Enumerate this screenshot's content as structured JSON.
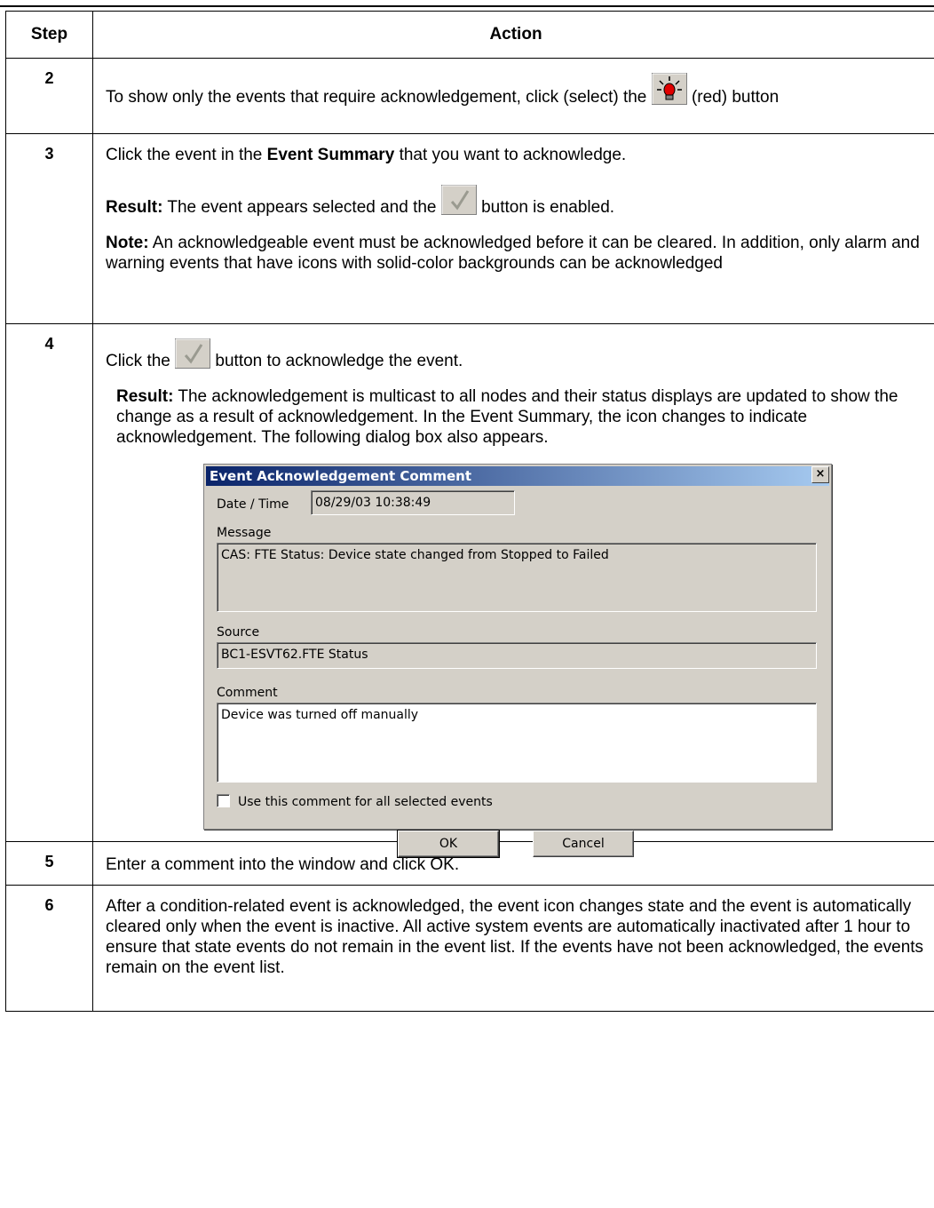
{
  "table": {
    "headers": {
      "step": "Step",
      "action": "Action"
    },
    "rows": [
      {
        "step": "2",
        "text_before_icon": "To show only the events that require acknowledgement, click (select) the",
        "text_after_icon": "(red) button",
        "icon": "red-alarm-light-icon"
      },
      {
        "step": "3",
        "line1_pre": "Click the event in the",
        "line1_bold": "Event Summary",
        "line1_post": "that you want to acknowledge.",
        "result_label": "Result:",
        "result_pre": "The event appears selected and the",
        "result_post": "button is enabled.",
        "note_label": "Note:",
        "note_text": "An acknowledgeable event must be acknowledged before it can be cleared. In addition, only alarm and warning events that have icons with solid-color backgrounds can be acknowledged"
      },
      {
        "step": "4",
        "click_pre": "Click the",
        "click_post": "button to acknowledge the event.",
        "result_label": "Result:",
        "result_text": "The acknowledgement is multicast to all nodes and their status displays are updated to show the change as a result of acknowledgement. In the Event Summary, the icon changes to indicate acknowledgement. The following dialog box also appears."
      },
      {
        "step": "5",
        "text": "Enter a comment into the window and click OK."
      },
      {
        "step": "6",
        "text": "After a condition-related event is acknowledged, the event icon changes state and the event is automatically cleared only when the event is inactive. All active system events are automatically inactivated after 1 hour to ensure that state events do not remain in the event list. If the events have not been acknowledged, the events remain on the event list."
      }
    ]
  },
  "dialog": {
    "title": "Event Acknowledgement Comment",
    "close_glyph": "×",
    "date_label": "Date / Time",
    "date_value": "08/29/03 10:38:49",
    "message_label": "Message",
    "message_value": "CAS: FTE Status: Device state changed from Stopped to  Failed",
    "source_label": "Source",
    "source_value": "BC1-ESVT62.FTE Status",
    "comment_label": "Comment",
    "comment_value": "Device was turned off manually",
    "checkbox_label": "Use this comment for all selected events",
    "ok_label": "OK",
    "cancel_label": "Cancel"
  }
}
